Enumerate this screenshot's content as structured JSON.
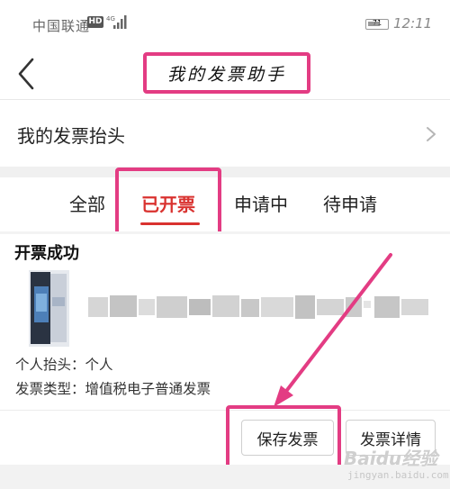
{
  "status_bar": {
    "carrier": "中国联通",
    "network_badge": "HD",
    "network_type": "4G",
    "battery_level": 0.71,
    "battery_text": "71",
    "time": "12:11"
  },
  "header": {
    "back_icon": "chevron-left-icon",
    "title": "我的发票助手"
  },
  "invoice_title_row": {
    "label": "我的发票抬头",
    "chevron_icon": "chevron-right-icon"
  },
  "tabs": [
    {
      "label": "全部",
      "active": false
    },
    {
      "label": "已开票",
      "active": true
    },
    {
      "label": "申请中",
      "active": false
    },
    {
      "label": "待申请",
      "active": false
    }
  ],
  "invoice_card": {
    "status": "开票成功",
    "holder_line": "个人抬头：个人",
    "type_line": "发票类型：增值税电子普通发票"
  },
  "actions": {
    "save_label": "保存发票",
    "detail_label": "发票详情"
  },
  "colors": {
    "accent_red": "#d9322f",
    "annotation_pink": "#e33c83"
  },
  "watermark": {
    "brand": "Baidu经验",
    "url": "jingyan.baidu.com"
  }
}
